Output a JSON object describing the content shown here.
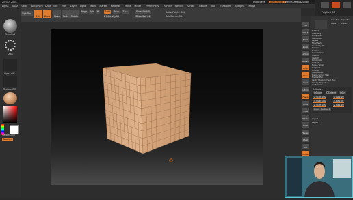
{
  "app": {
    "title": "ZBrush 2018.1",
    "quicksave": "QuickSave",
    "see_through": "See-through 0",
    "menus": "Menus",
    "default_zscript": "DefaultZScript"
  },
  "menubar": [
    "Alpha",
    "Brush",
    "Color",
    "Document",
    "Draw",
    "Edit",
    "File",
    "Layer",
    "Light",
    "Macro",
    "Marker",
    "Material",
    "Movie",
    "Picker",
    "Preferences",
    "Render",
    "Stencil",
    "Stroke",
    "Texture",
    "Tool",
    "Transform",
    "Zplugin",
    "Zscript"
  ],
  "toolshelf": {
    "projection_master": "Projection Master",
    "lightbox": "LightBox",
    "edit": "Edit",
    "draw": "Draw",
    "move": "Move",
    "scale": "Scale",
    "rotate": "Rotate",
    "mrgb": "Mrgb",
    "rgb": "Rgb",
    "m": "M",
    "zadd": "Zadd",
    "zsub": "Zsub",
    "zcut": "Zcut",
    "z_intensity": "Z Intensity 25",
    "focal_shift": "Focal Shift 0",
    "draw_size": "Draw Size 64",
    "active_points": "ActivePoints: 384",
    "total_points": "TotalPoints: 384"
  },
  "leftshelf": {
    "standard": "Standard",
    "dots": "Dots",
    "alpha_off": "Alpha Off",
    "texture_off": "Texture Off",
    "switch_color": "SwitchColor",
    "gradient": "Gradient"
  },
  "rightshelf": [
    "BPR",
    "SPix 3",
    "Scroll",
    "Zoom",
    "Actual",
    "AAHalf",
    "Persp",
    "Floor",
    "Local",
    "L.Sym",
    "Frame",
    "Move",
    "Scale",
    "Rotate",
    "PolyF",
    "Transp",
    "Ghost",
    "Solo",
    "Xpose"
  ],
  "tray": {
    "top_labels": [
      "Load Tool",
      "Copy Tool",
      "Import",
      "Export",
      "Clone",
      "Make PolyMesh3D",
      "GoZ",
      "All",
      "Visible",
      "R"
    ],
    "current_tool": "PolyMesh3D",
    "items": [
      "Subtool",
      "Geometry",
      "ArrayMesh",
      "NanoMesh",
      "Layers",
      "FiberMesh",
      "Geometry HD",
      "Preview",
      "Surface",
      "Deformation",
      "Masking",
      "Visibility",
      "Polygroups",
      "Contact",
      "Morph Target",
      "Polypaint",
      "UV Map",
      "Texture Map",
      "Displacement Map",
      "Normal Map",
      "Vector Displacement Map",
      "Display Properties",
      "Unified Skin",
      "Initialize",
      "Import",
      "Export"
    ]
  },
  "initialize_panel": {
    "title": "Initialize",
    "qcube": "QCube",
    "qsphere": "QSphere",
    "qcyl": "QCyl",
    "x_size": "X Size 100",
    "y_size": "Y Size 100",
    "z_size": "Z Size 100",
    "x_res": "X Res 10",
    "y_res": "Y Res 10",
    "z_res": "Z Res 10",
    "inner_radius": "Inner Radius 0"
  },
  "colors": {
    "accent": "#e07a2c",
    "canvas_top": "#050505",
    "canvas_bottom": "#4a4a4a",
    "cube_face": "#d8a880",
    "cube_grid": "#9c7452",
    "webcam_border": "#5ec8d8"
  }
}
